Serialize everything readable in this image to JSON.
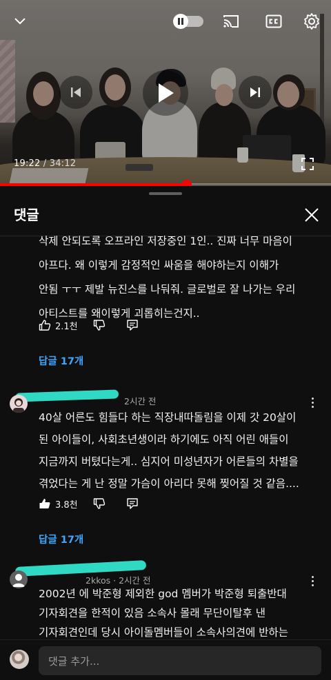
{
  "player": {
    "current_time": "19:22",
    "separator": " / ",
    "duration": "34:12",
    "progress_fraction": 0.565,
    "icons": [
      "chevron-down-icon",
      "autoplay-toggle-icon",
      "cast-icon",
      "captions-icon",
      "gear-icon",
      "previous-icon",
      "play-icon",
      "next-icon",
      "fullscreen-icon"
    ],
    "accent_color": "#ff0000"
  },
  "comments_panel": {
    "title": "댓글",
    "comments": [
      {
        "lines": [
          "삭제 안되도록 오프라인 저장중인 1인.. 진짜 너무 마음이",
          "아프다. 왜 이렇게 감정적인 싸움을 해야하는지 이해가",
          "안됨 ㅜㅜ 제발 뉴진스를 나둬줘. 글로벌로 잘 나가는 우리",
          "아티스트를 왜이렇게 괴롭히는건지.."
        ],
        "likes": "2.1천",
        "replies": "답글 17개"
      },
      {
        "author_suffix": "",
        "time": "2시간 전",
        "lines": [
          "40살 어른도 힘들다 하는 직장내따돌림을 이제 갓 20살이",
          "된 아이들이, 사회초년생이라 하기에도 아직 어린 애들이",
          "지금까지 버텼다는게.. 심지어 미성년자가 어른들의 차별을",
          "겪었다는 게 난 정말 가슴이 아리다 못해 찢어질 것 같음...."
        ],
        "likes": "3.8천",
        "replies": "답글 17개"
      },
      {
        "author_suffix": "2kkos",
        "time": "2시간 전",
        "lines": [
          "2002년 에  박준형 제외한 god 멤버가 박준형 퇴출반대",
          "기자회견을 한적이 있음   소속사 몰래 무단이탈후 낸",
          "기자회견인데 당시 아이돌멤버들이 소속사의견에 반하는"
        ]
      }
    ],
    "composer_placeholder": "댓글 추가..."
  }
}
